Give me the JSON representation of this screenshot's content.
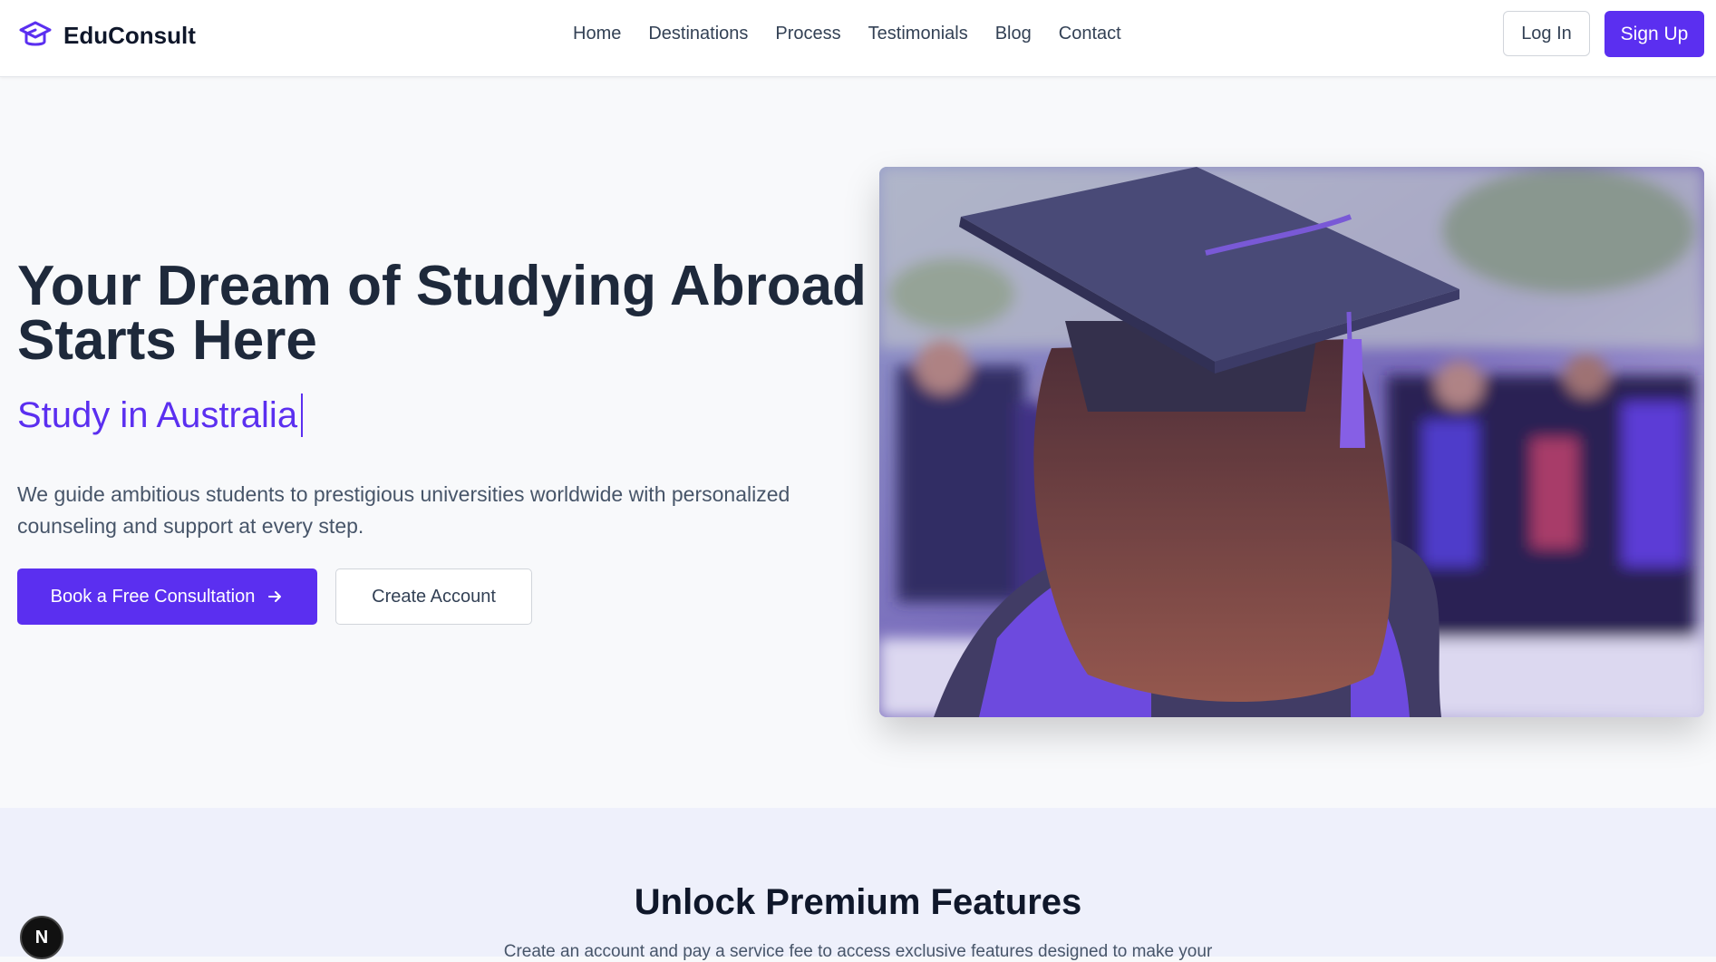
{
  "brand": {
    "name": "EduConsult",
    "accent": "#5b2ff0"
  },
  "nav": [
    "Home",
    "Destinations",
    "Process",
    "Testimonials",
    "Blog",
    "Contact"
  ],
  "auth": {
    "login": "Log In",
    "signup": "Sign Up"
  },
  "hero": {
    "title": "Your Dream of Studying Abroad Starts Here",
    "subtitle": "Study in Australia",
    "description": "We guide ambitious students to prestigious universities worldwide with personalized counseling and support at every step.",
    "primary_cta": "Book a Free Consultation",
    "secondary_cta": "Create Account"
  },
  "features": {
    "title": "Unlock Premium Features",
    "description": "Create an account and pay a service fee to access exclusive features designed to make your"
  },
  "dev_badge": "N",
  "icons": {
    "logo": "graduation-cap-icon",
    "cta_arrow": "arrow-right-icon"
  }
}
